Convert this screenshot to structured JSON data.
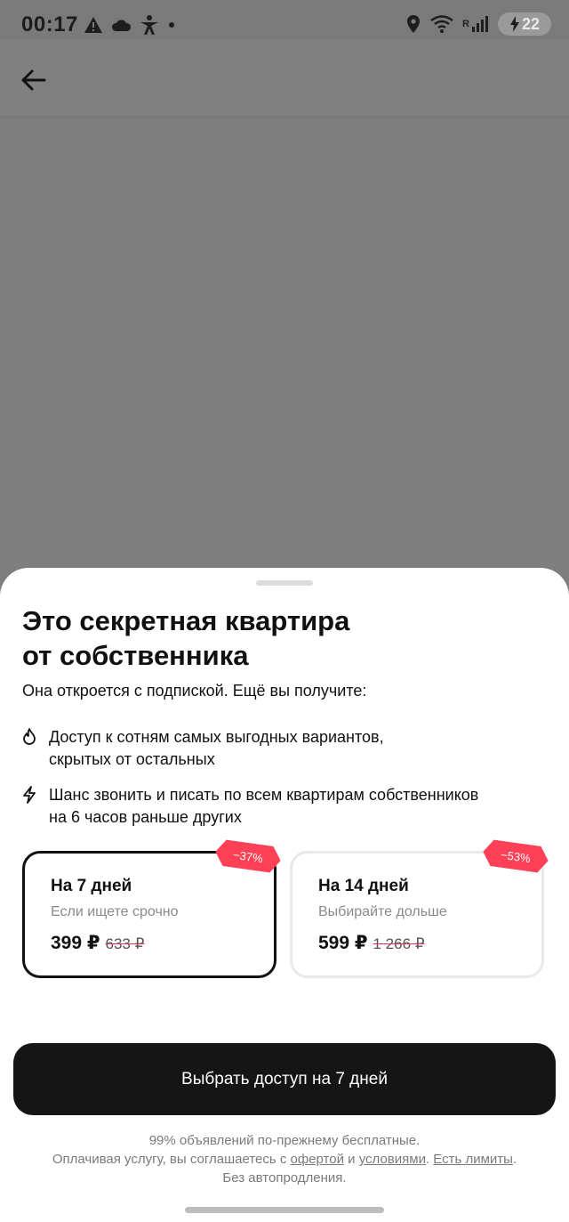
{
  "status_bar": {
    "time": "00:17",
    "network_tag": "6",
    "roaming_tag": "R",
    "battery": "22"
  },
  "sheet": {
    "title_line1": "Это секретная квартира",
    "title_line2": "от собственника",
    "subtitle": "Она откроется с подпиской. Ещё вы получите:",
    "features": [
      {
        "icon": "flame-icon",
        "line1": "Доступ к сотням самых выгодных вариантов,",
        "line2": "скрытых от остальных"
      },
      {
        "icon": "lightning-icon",
        "line1": "Шанс звонить и писать по всем квартирам собственников",
        "line2": "на 6 часов раньше других"
      }
    ],
    "plans": [
      {
        "name": "На 7 дней",
        "desc": "Если ищете срочно",
        "price": "399 ₽",
        "old_price": "633 ₽",
        "discount": "−37%",
        "selected": true
      },
      {
        "name": "На 14 дней",
        "desc": "Выбирайте дольше",
        "price": "599 ₽",
        "old_price": "1 266 ₽",
        "discount": "−53%",
        "selected": false
      }
    ],
    "cta_label": "Выбрать доступ на 7 дней",
    "footer": {
      "line1": "99% объявлений по-прежнему бесплатные.",
      "line2_prefix": "Оплачивая услугу, вы соглашаетесь с ",
      "offer_link": "офертой",
      "and": " и ",
      "terms_link": "условиями",
      "dot": ". ",
      "limits_link": "Есть лимиты",
      "line2_end": ".",
      "line3": "Без автопродления."
    }
  },
  "colors": {
    "discount_badge": "#ff4057",
    "cta_bg": "#151515",
    "scrim": "#7e7e7e"
  }
}
